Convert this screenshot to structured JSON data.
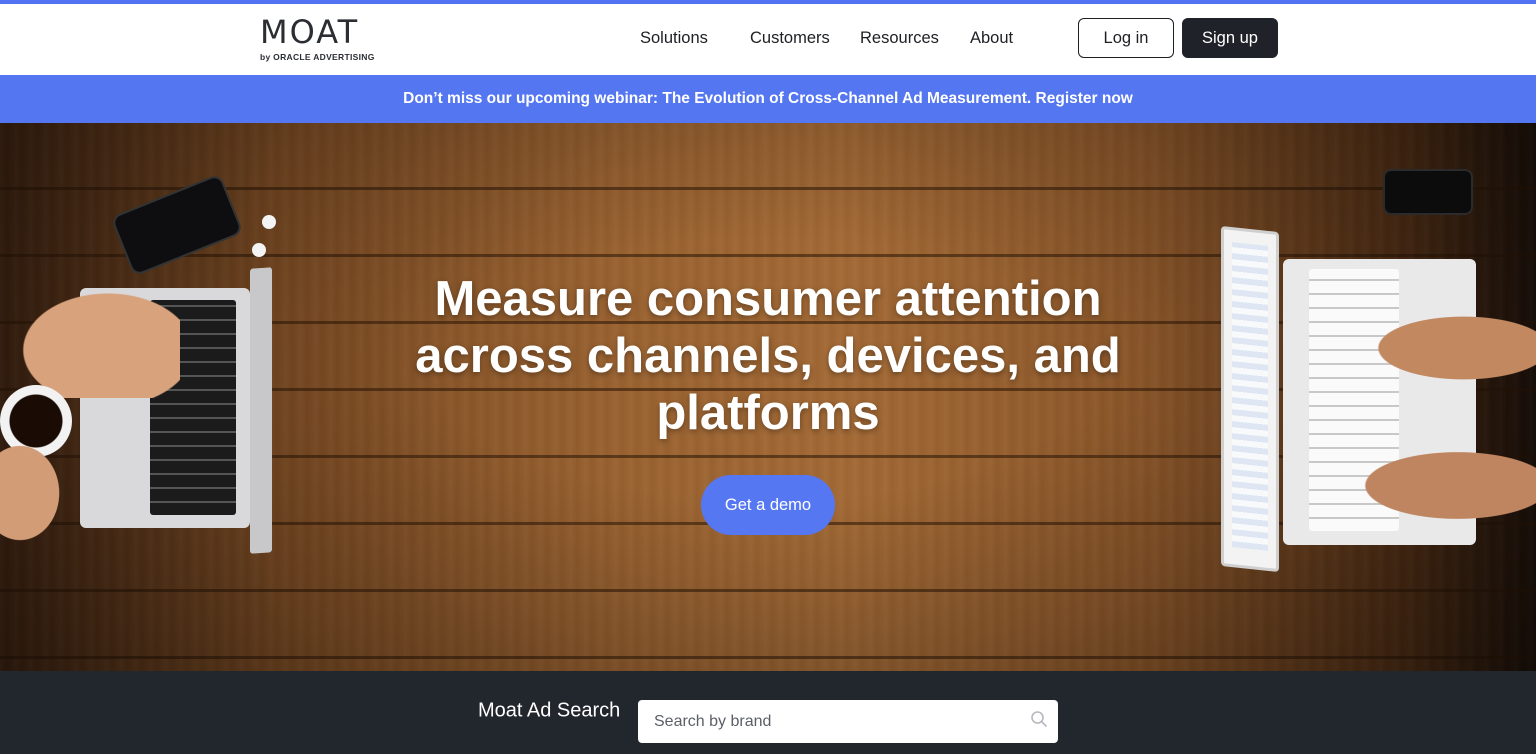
{
  "brand": {
    "name": "MOAT",
    "sub": "by ORACLE ADVERTISING"
  },
  "nav": {
    "items": [
      {
        "label": "Solutions"
      },
      {
        "label": "Customers"
      },
      {
        "label": "Resources"
      },
      {
        "label": "About"
      }
    ],
    "login_label": "Log in",
    "signup_label": "Sign up"
  },
  "banner": {
    "text": "Don’t miss our upcoming webinar: The Evolution of Cross-Channel Ad Measurement. Register now"
  },
  "hero": {
    "title": "Measure consumer attention across channels, devices, and platforms",
    "cta_label": "Get a demo"
  },
  "ad_search": {
    "label": "Moat Ad Search",
    "placeholder": "Search by brand",
    "value": ""
  },
  "colors": {
    "accent": "#5476f0",
    "dark": "#22262d",
    "signup_bg": "#1f2228"
  },
  "icons": {
    "search": "search-icon"
  }
}
